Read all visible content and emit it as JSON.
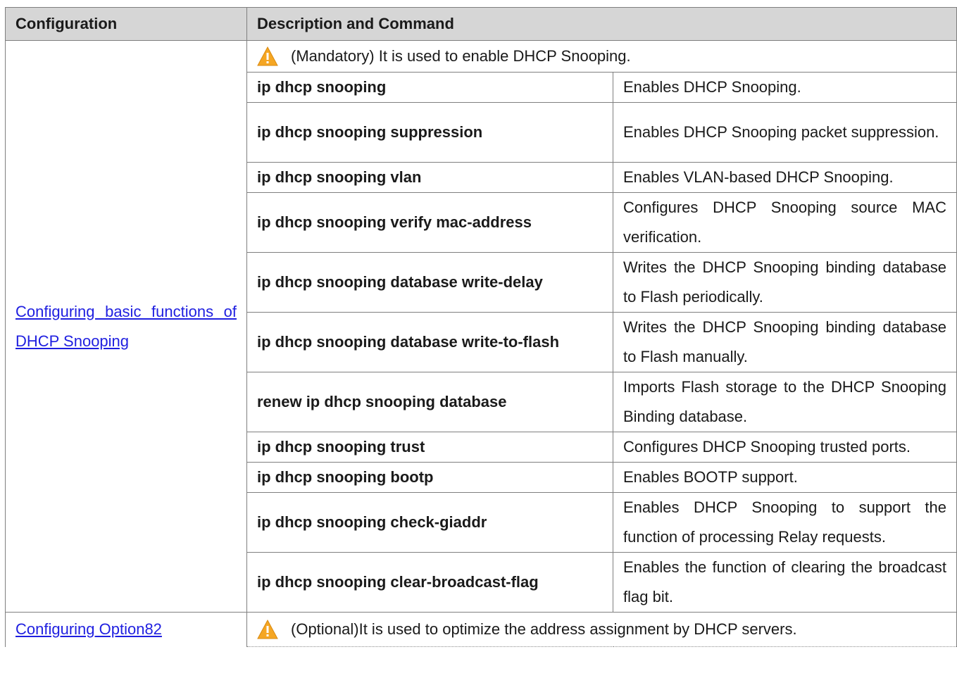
{
  "header": {
    "configuration": "Configuration",
    "description_and_command": "Description and Command"
  },
  "sections": [
    {
      "link": "Configuring basic functions of DHCP Snooping",
      "note": "(Mandatory) It is used to enable DHCP Snooping.",
      "commands": [
        {
          "command": "ip dhcp snooping",
          "description": "Enables DHCP Snooping."
        },
        {
          "command": "ip dhcp snooping suppression",
          "description": "Enables DHCP Snooping packet suppression."
        },
        {
          "command": "ip dhcp snooping vlan",
          "description": "Enables VLAN-based DHCP Snooping."
        },
        {
          "command": "ip dhcp snooping verify mac-address",
          "description": "Configures DHCP Snooping source MAC verification."
        },
        {
          "command": "ip dhcp snooping database write-delay",
          "description": "Writes the DHCP Snooping binding database to Flash periodically."
        },
        {
          "command": "ip dhcp snooping database write-to-flash",
          "description": "Writes the DHCP Snooping binding database to Flash manually."
        },
        {
          "command": "renew ip dhcp snooping database",
          "description": "Imports Flash storage to the DHCP Snooping Binding database."
        },
        {
          "command": "ip dhcp snooping trust",
          "description": "Configures DHCP Snooping trusted ports."
        },
        {
          "command": "ip dhcp snooping bootp",
          "description": "Enables BOOTP support."
        },
        {
          "command": "ip dhcp snooping check-giaddr",
          "description": "Enables DHCP Snooping to support the function of processing Relay requests."
        },
        {
          "command": "ip dhcp snooping clear-broadcast-flag",
          "description": "Enables the function of clearing the broadcast flag bit."
        }
      ]
    },
    {
      "link": "Configuring Option82",
      "note": "(Optional)It is used to optimize the address assignment by DHCP servers."
    }
  ],
  "icons": {
    "warning": "warning-triangle-icon"
  },
  "colors": {
    "link": "#1f1fe0",
    "header_bg": "#d6d6d6",
    "warning": "#f5a623"
  }
}
